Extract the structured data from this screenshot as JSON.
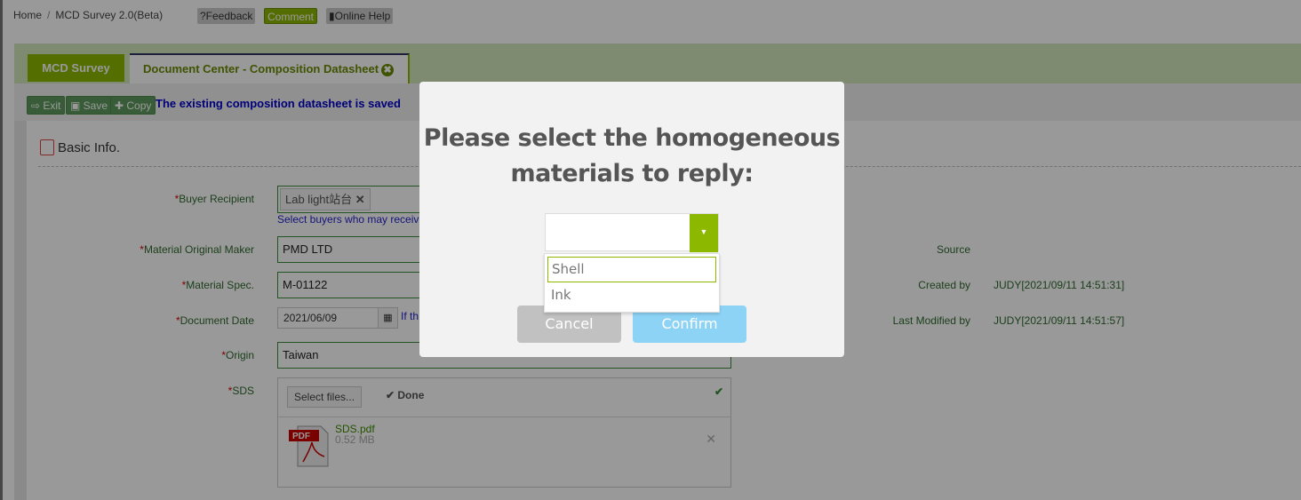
{
  "breadcrumb": {
    "home": "Home",
    "sep": "/",
    "current": "MCD Survey 2.0(Beta)"
  },
  "top_buttons": {
    "feedback": "?Feedback",
    "comment": "Comment",
    "online_help": "Online Help"
  },
  "tabs": [
    {
      "label": "MCD Survey"
    },
    {
      "label": "Document Center - Composition Datasheet",
      "close": "✖"
    }
  ],
  "toolbar": {
    "exit": "Exit",
    "save": "Save",
    "copy": "Copy",
    "message": "The existing composition datasheet is saved"
  },
  "section": {
    "title": "Basic Info."
  },
  "form": {
    "buyer_recipient": {
      "label": "Buyer Recipient",
      "chip": "Lab light站台",
      "hint": "Select buyers who may receiv"
    },
    "maker": {
      "label": "Material Original Maker",
      "value": "PMD LTD"
    },
    "spec": {
      "label": "Material Spec.",
      "value": "M-01122"
    },
    "doc_date": {
      "label": "Document Date",
      "value": "2021/06/09",
      "hint": "If th"
    },
    "origin": {
      "label": "Origin",
      "value": "Taiwan"
    },
    "sds": {
      "label": "SDS",
      "select_files": "Select files...",
      "done": "Done",
      "file_name": "SDS.pdf",
      "file_size": "0.52 MB"
    }
  },
  "info": {
    "source_label": "Source",
    "created_label": "Created by",
    "created_value": "JUDY[2021/09/11 14:51:31]",
    "modified_label": "Last Modified by",
    "modified_value": "JUDY[2021/09/11 14:51:57]"
  },
  "modal": {
    "title": "Please select the homogeneous materials to reply:",
    "select_value": "",
    "options": [
      "Shell",
      "Ink"
    ],
    "cancel": "Cancel",
    "confirm": "Confirm"
  },
  "colors": {
    "accent_green": "#8cb800",
    "confirm_blue": "#8dd3f6",
    "label_green": "#2f6a2f"
  }
}
